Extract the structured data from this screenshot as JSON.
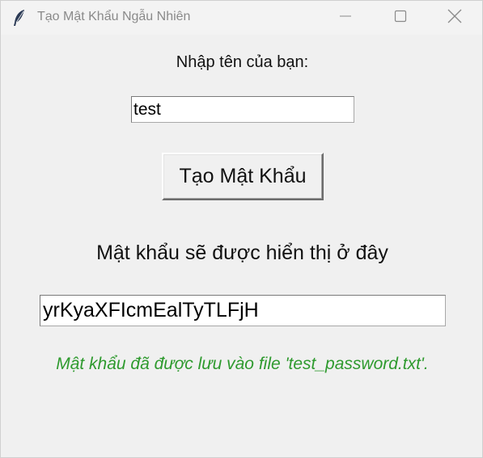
{
  "window": {
    "title": "Tạo Mật Khẩu Ngẫu Nhiên",
    "app_icon": "feather-icon",
    "controls": {
      "minimize_icon": "minimize-icon",
      "maximize_icon": "maximize-icon",
      "close_icon": "close-icon"
    }
  },
  "form": {
    "name_label": "Nhập tên của bạn:",
    "name_value": "test",
    "generate_button_label": "Tạo Mật Khẩu",
    "password_label": "Mật khẩu sẽ được hiển thị ở đây",
    "password_value": "yrKyaXFIcmEalTyTLFjH",
    "status_message": "Mật khẩu đã được lưu vào file 'test_password.txt'."
  },
  "colors": {
    "background": "#f0f0f0",
    "status_text": "#2e9a2e",
    "title_text": "#8a8a8a"
  }
}
